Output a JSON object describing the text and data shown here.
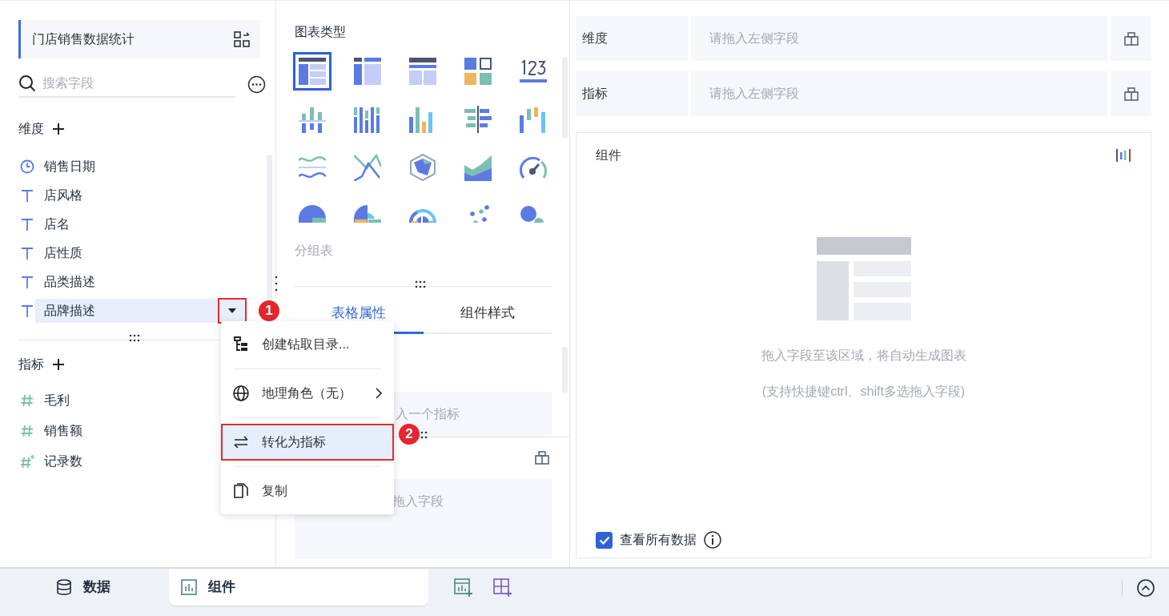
{
  "dataset": {
    "title": "门店销售数据统计"
  },
  "search": {
    "placeholder": "搜索字段"
  },
  "dimensions": {
    "label": "维度",
    "fields": [
      {
        "name": "销售日期",
        "kind": "date",
        "selected": false
      },
      {
        "name": "店风格",
        "kind": "text",
        "selected": false
      },
      {
        "name": "店名",
        "kind": "text",
        "selected": false
      },
      {
        "name": "店性质",
        "kind": "text",
        "selected": false
      },
      {
        "name": "品类描述",
        "kind": "text",
        "selected": false
      },
      {
        "name": "品牌描述",
        "kind": "text",
        "selected": true,
        "callout": "1"
      }
    ]
  },
  "measures": {
    "label": "指标",
    "fields": [
      {
        "name": "毛利",
        "kind": "number"
      },
      {
        "name": "销售额",
        "kind": "number"
      },
      {
        "name": "记录数",
        "kind": "count"
      }
    ]
  },
  "chart_types": {
    "title": "图表类型",
    "hint": "分组表",
    "items": [
      {
        "kind": "grouped-table",
        "selected": true
      },
      {
        "kind": "cross-table",
        "selected": false
      },
      {
        "kind": "detail-table",
        "selected": false
      },
      {
        "kind": "kpi-card",
        "selected": false
      },
      {
        "kind": "number",
        "selected": false
      },
      {
        "kind": "bar-pos-neg",
        "selected": false
      },
      {
        "kind": "bar-stacked",
        "selected": false
      },
      {
        "kind": "bar-multi",
        "selected": false
      },
      {
        "kind": "bar-horizontal",
        "selected": false
      },
      {
        "kind": "bar-range",
        "selected": false
      },
      {
        "kind": "line-wave",
        "selected": false
      },
      {
        "kind": "line-cross",
        "selected": false
      },
      {
        "kind": "radar",
        "selected": false
      },
      {
        "kind": "area",
        "selected": false
      },
      {
        "kind": "gauge",
        "selected": false
      },
      {
        "kind": "pie",
        "selected": false
      },
      {
        "kind": "pie-rose",
        "selected": false
      },
      {
        "kind": "pie-multi",
        "selected": false
      },
      {
        "kind": "scatter",
        "selected": false
      },
      {
        "kind": "bubble",
        "selected": false
      }
    ]
  },
  "property_tabs": [
    {
      "label": "表格属性",
      "selected": true
    },
    {
      "label": "组件样式",
      "selected": false
    }
  ],
  "property_drops": [
    {
      "hint": "入一个指标"
    },
    {
      "hint": "拖入字段"
    }
  ],
  "shelves": [
    {
      "label": "维度",
      "placeholder": "请拖入左侧字段"
    },
    {
      "label": "指标",
      "placeholder": "请拖入左侧字段"
    }
  ],
  "component": {
    "title": "组件",
    "empty_text": "拖入字段至该区域，将自动生成图表",
    "empty_hint": "(支持快捷键ctrl、shift多选拖入字段)",
    "show_all": {
      "label": "查看所有数据",
      "checked": true
    }
  },
  "context_menu": {
    "items": [
      {
        "label": "创建钻取目录...",
        "kind": "tree",
        "submenu": false,
        "selected": false
      },
      {
        "label": "地理角色（无）",
        "kind": "globe",
        "submenu": true,
        "selected": false
      },
      {
        "label": "转化为指标",
        "kind": "swap",
        "submenu": false,
        "selected": true,
        "callout": "2"
      },
      {
        "label": "复制",
        "kind": "copy",
        "submenu": false,
        "selected": false
      }
    ]
  },
  "bottom_tabs": [
    {
      "label": "数据",
      "kind": "data",
      "selected": false
    },
    {
      "label": "组件",
      "kind": "component",
      "selected": true
    }
  ]
}
